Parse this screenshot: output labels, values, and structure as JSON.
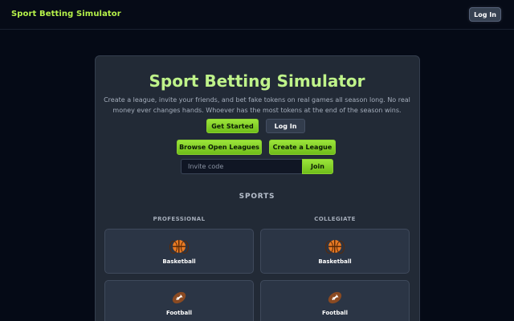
{
  "header": {
    "brand": "Sport Betting Simulator",
    "login_label": "Log In"
  },
  "hero": {
    "title": "Sport Betting Simulator",
    "subtitle": "Create a league, invite your friends, and bet fake tokens on real games all season long. No real money ever changes hands. Whoever has the most tokens at the end of the season wins.",
    "get_started_label": "Get Started",
    "login_label": "Log In",
    "browse_label": "Browse Open Leagues",
    "create_label": "Create a League",
    "invite_placeholder": "Invite code",
    "invite_value": "",
    "join_label": "Join"
  },
  "sports": {
    "heading": "SPORTS",
    "columns": [
      {
        "heading": "PROFESSIONAL",
        "items": [
          {
            "label": "Basketball",
            "icon": "basketball-icon"
          },
          {
            "label": "Football",
            "icon": "football-icon"
          }
        ]
      },
      {
        "heading": "COLLEGIATE",
        "items": [
          {
            "label": "Basketball",
            "icon": "basketball-icon"
          },
          {
            "label": "Football",
            "icon": "football-icon"
          }
        ]
      }
    ]
  },
  "colors": {
    "accent": "#9be43a",
    "brand": "#b6f24a",
    "background": "#050a16",
    "card": "#222a36"
  }
}
